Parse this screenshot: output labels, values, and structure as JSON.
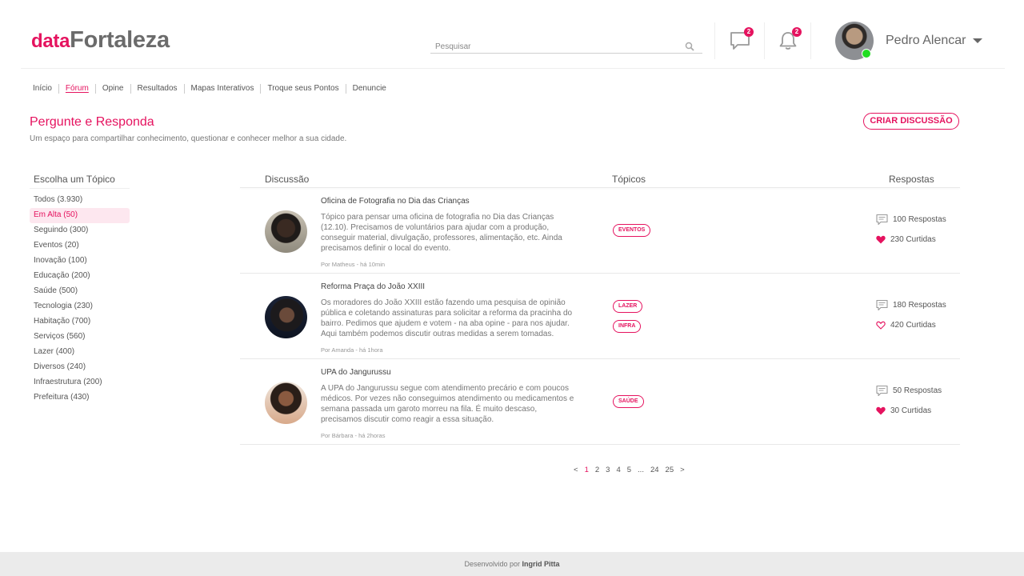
{
  "header": {
    "logo_prefix": "data",
    "logo_main": "Fortaleza",
    "search_placeholder": "Pesquisar",
    "messages_count": "2",
    "notifications_count": "2",
    "username": "Pedro Alencar"
  },
  "nav": [
    "Início",
    "Fórum",
    "Opine",
    "Resultados",
    "Mapas Interativos",
    "Troque seus Pontos",
    "Denuncie"
  ],
  "nav_active": "Fórum",
  "page": {
    "title": "Pergunte e Responda",
    "subtitle": "Um espaço para compartilhar conhecimento, questionar e conhecer melhor a sua cidade.",
    "create_button": "CRIAR DISCUSSÃO"
  },
  "sidebar": {
    "title": "Escolha um Tópico",
    "items": [
      "Todos (3.930)",
      "Em Alta (50)",
      "Seguindo (300)",
      "Eventos (20)",
      "Inovação (100)",
      "Educação (200)",
      "Saúde (500)",
      "Tecnologia (230)",
      "Habitação (700)",
      "Serviços (560)",
      "Lazer (400)",
      "Diversos (240)",
      "Infraestrutura (200)",
      "Prefeitura (430)"
    ],
    "active_index": 1
  },
  "table": {
    "col_discussion": "Discussão",
    "col_topics": "Tópicos",
    "col_replies": "Respostas"
  },
  "discussions": [
    {
      "title": "Oficina de Fotografia no Dia das Crianças",
      "description": "Tópico para pensar uma oficina de fotografia no Dia das Crianças (12.10). Precisamos de voluntários para ajudar com a produção, conseguir material, divulgação, professores, alimentação, etc. Ainda precisamos definir o local do evento.",
      "meta": "Por Matheus - há 10min",
      "tags": [
        "EVENTOS"
      ],
      "replies": "100 Respostas",
      "likes": "230 Curtidas",
      "liked": true
    },
    {
      "title": "Reforma Praça do João XXIII",
      "description": "Os moradores do João XXIII estão fazendo uma pesquisa de opinião pública e coletando assinaturas para solicitar a reforma da pracinha do bairro. Pedimos que ajudem e votem - na aba opine - para nos ajudar. Aqui também podemos discutir outras medidas a serem tomadas.",
      "meta": "Por Amanda - há 1hora",
      "tags": [
        "LAZER",
        "INFRA"
      ],
      "replies": "180 Respostas",
      "likes": "420 Curtidas",
      "liked": false
    },
    {
      "title": "UPA do Jangurussu",
      "description": "A UPA do Jangurussu segue com atendimento precário e com poucos médicos. Por vezes não conseguimos atendimento ou medicamentos e semana passada um garoto morreu na fila. É muito descaso, precisamos discutir como reagir a essa situação.",
      "meta": "Por Bárbara - há 2horas",
      "tags": [
        "SAÚDE"
      ],
      "replies": "50 Respostas",
      "likes": "30 Curtidas",
      "liked": true
    }
  ],
  "pagination": [
    "<",
    "1",
    "2",
    "3",
    "4",
    "5",
    "...",
    "24",
    "25",
    ">"
  ],
  "pagination_active": "1",
  "footer": {
    "prefix": "Desenvolvido por",
    "author": "Ingrid Pitta"
  },
  "colors": {
    "accent": "#e5135f",
    "online": "#22dd22",
    "footer_bg": "#ebebeb"
  }
}
